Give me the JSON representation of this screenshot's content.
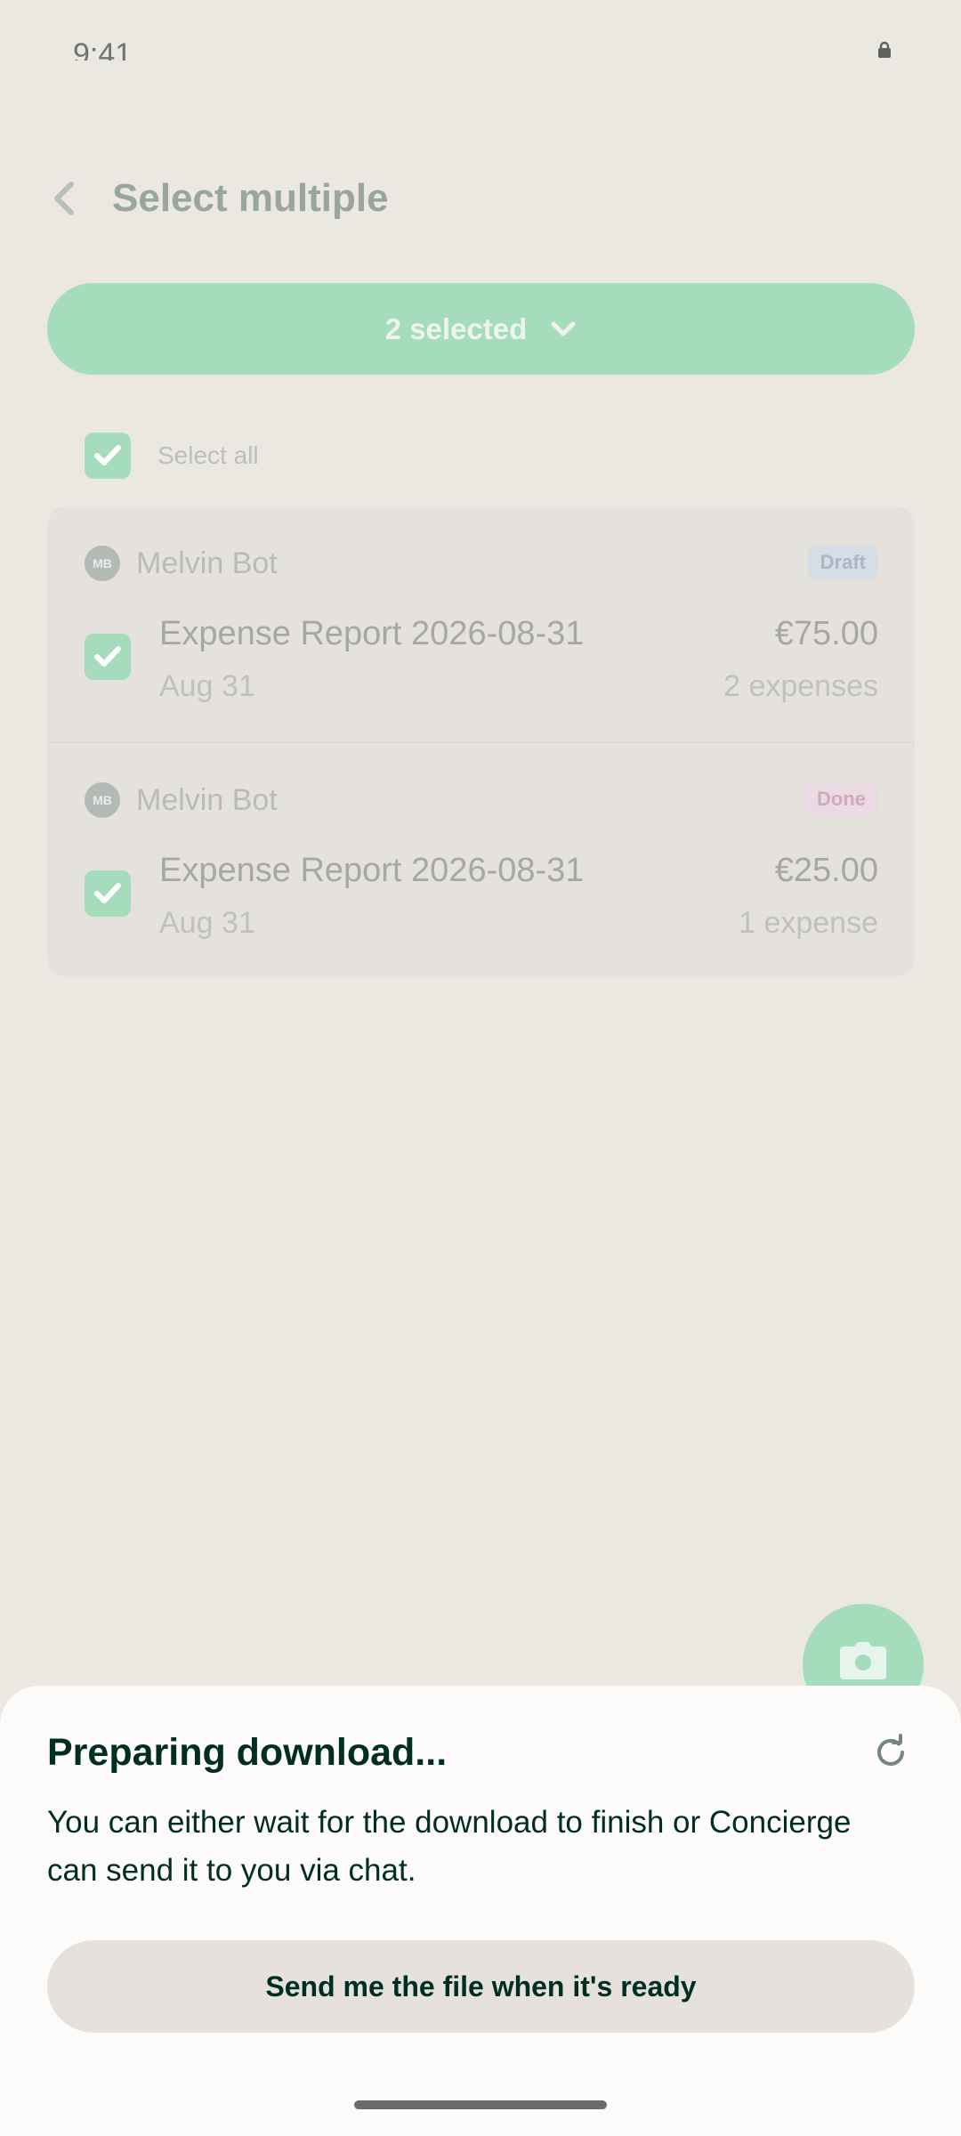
{
  "status_bar": {
    "time": "9:41",
    "icon": "lock-icon"
  },
  "header": {
    "back_icon": "chevron-left-icon",
    "title": "Select multiple"
  },
  "selection": {
    "label": "2 selected",
    "icon": "chevron-down-icon"
  },
  "select_all": {
    "label": "Select all",
    "checked": true
  },
  "reports": [
    {
      "avatar": "MB",
      "author": "Melvin Bot",
      "status": "Draft",
      "title": "Expense Report 2026-08-31",
      "date": "Aug 31",
      "amount": "€75.00",
      "count": "2 expenses",
      "checked": true
    },
    {
      "avatar": "MB",
      "author": "Melvin Bot",
      "status": "Done",
      "title": "Expense Report 2026-08-31",
      "date": "Aug 31",
      "amount": "€25.00",
      "count": "1 expense",
      "checked": true
    }
  ],
  "fab": {
    "icon": "camera-icon"
  },
  "sheet": {
    "title": "Preparing download...",
    "body": "You can either wait for the download to finish or Concierge can send it to you via chat.",
    "button_label": "Send me the file when it's ready",
    "icon": "refresh-icon"
  },
  "colors": {
    "accent": "#a5ddbc",
    "text_dark": "#002e22",
    "background": "#ebe7e1",
    "sheet": "#fcfbf9",
    "draft_badge": "#d6dde4",
    "done_badge": "#eadbe2"
  }
}
